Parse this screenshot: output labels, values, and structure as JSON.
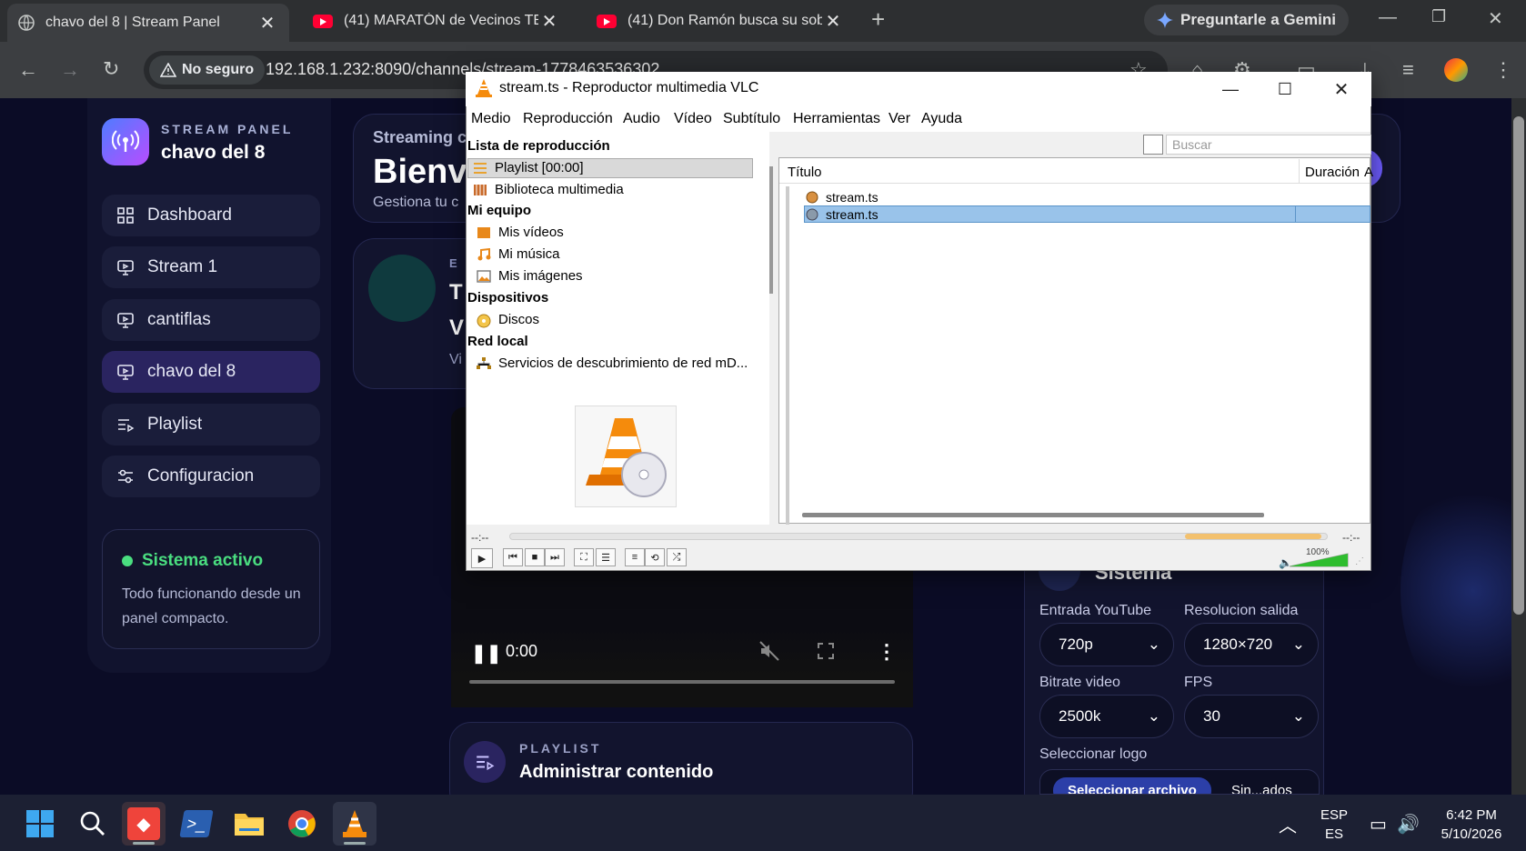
{
  "browser": {
    "tabs": [
      {
        "title": "chavo del 8 | Stream Panel",
        "active": true
      },
      {
        "title": "(41) MARATÓN de Vecinos TEM",
        "active": false
      },
      {
        "title": "(41) Don Ramón busca su sobre",
        "active": false
      }
    ],
    "gemini_label": "Preguntarle a Gemini",
    "security_label": "No seguro",
    "url": "192.168.1.232:8090/channels/stream-1778463536302"
  },
  "panel": {
    "brand_subtitle": "STREAM PANEL",
    "brand_name": "chavo del 8",
    "nav": [
      {
        "label": "Dashboard",
        "icon": "grid-icon"
      },
      {
        "label": "Stream 1",
        "icon": "monitor-icon"
      },
      {
        "label": "cantiflas",
        "icon": "monitor-icon"
      },
      {
        "label": "chavo del 8",
        "icon": "monitor-icon",
        "active": true
      },
      {
        "label": "Playlist",
        "icon": "playlist-icon"
      },
      {
        "label": "Configuracion",
        "icon": "sliders-icon"
      }
    ],
    "status_title": "Sistema activo",
    "status_text": "Todo funcionando desde un panel compacto.",
    "header_small": "Streaming c",
    "header_big": "Bienv",
    "header_sub": "Gestiona tu c",
    "stream_card": {
      "eyebrow": "E",
      "line1": "T",
      "line2": "V",
      "line3": "Vi"
    },
    "video": {
      "time": "0:00"
    },
    "playlist_card": {
      "eyebrow": "PLAYLIST",
      "title": "Administrar contenido"
    },
    "system": {
      "title": "Sistema",
      "entrada_label": "Entrada YouTube",
      "entrada_value": "720p",
      "resolucion_label": "Resolucion salida",
      "resolucion_value": "1280×720",
      "bitrate_label": "Bitrate video",
      "bitrate_value": "2500k",
      "fps_label": "FPS",
      "fps_value": "30",
      "logo_label": "Seleccionar logo",
      "logo_button": "Seleccionar archivo",
      "logo_status": "Sin...ados"
    }
  },
  "vlc": {
    "title": "stream.ts - Reproductor multimedia VLC",
    "menu": [
      "Medio",
      "Reproducción",
      "Audio",
      "Vídeo",
      "Subtítulo",
      "Herramientas",
      "Ver",
      "Ayuda"
    ],
    "sidebar_header": "Lista de reproducción",
    "playlist_item": "Playlist [00:00]",
    "media_library": "Biblioteca multimedia",
    "my_computer": "Mi equipo",
    "my_videos": "Mis vídeos",
    "my_music": "Mi música",
    "my_pictures": "Mis imágenes",
    "devices": "Dispositivos",
    "discs": "Discos",
    "local_network": "Red local",
    "network_services": "Servicios de descubrimiento de red mD...",
    "search_placeholder": "Buscar",
    "col_title": "Título",
    "col_duration": "Duración",
    "col_album": "A",
    "rows": [
      "stream.ts",
      "stream.ts"
    ],
    "time_elapsed": "--:--",
    "time_total": "--:--",
    "volume": "100%",
    "volume_level": 1.0
  },
  "taskbar": {
    "lang1": "ESP",
    "lang2": "ES",
    "time": "6:42 PM",
    "date": "5/10/2026"
  },
  "colors": {
    "page_bg": "#0b0c26",
    "accent_green": "#4ade80",
    "nav_active": "#2a2460",
    "vlc_orange": "#f58b0c",
    "selection": "#99c3ea"
  }
}
